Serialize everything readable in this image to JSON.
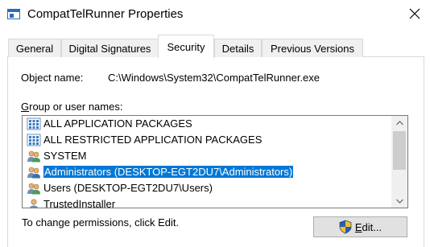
{
  "window": {
    "title": "CompatTelRunner Properties"
  },
  "tabs": [
    {
      "label": "General",
      "active": false
    },
    {
      "label": "Digital Signatures",
      "active": false
    },
    {
      "label": "Security",
      "active": true
    },
    {
      "label": "Details",
      "active": false
    },
    {
      "label": "Previous Versions",
      "active": false
    }
  ],
  "security": {
    "object_name_label": "Object name:",
    "object_name_value": "C:\\Windows\\System32\\CompatTelRunner.exe",
    "group_label_first": "G",
    "group_label_rest": "roup or user names:",
    "principals": [
      {
        "name": "ALL APPLICATION PACKAGES",
        "icon": "package-group-icon",
        "selected": false
      },
      {
        "name": "ALL RESTRICTED APPLICATION PACKAGES",
        "icon": "package-group-icon",
        "selected": false
      },
      {
        "name": "SYSTEM",
        "icon": "users-icon",
        "selected": false
      },
      {
        "name": "Administrators (DESKTOP-EGT2DU7\\Administrators)",
        "icon": "users-icon",
        "selected": true
      },
      {
        "name": "Users (DESKTOP-EGT2DU7\\Users)",
        "icon": "users-icon",
        "selected": false
      },
      {
        "name": "TrustedInstaller",
        "icon": "user-icon",
        "selected": false
      }
    ],
    "change_permissions_text": "To change permissions, click Edit.",
    "edit_button_first": "E",
    "edit_button_rest": "dit..."
  },
  "colors": {
    "selection": "#0078d7",
    "shield_blue": "#2b5fad",
    "shield_yellow": "#f2c12e"
  }
}
